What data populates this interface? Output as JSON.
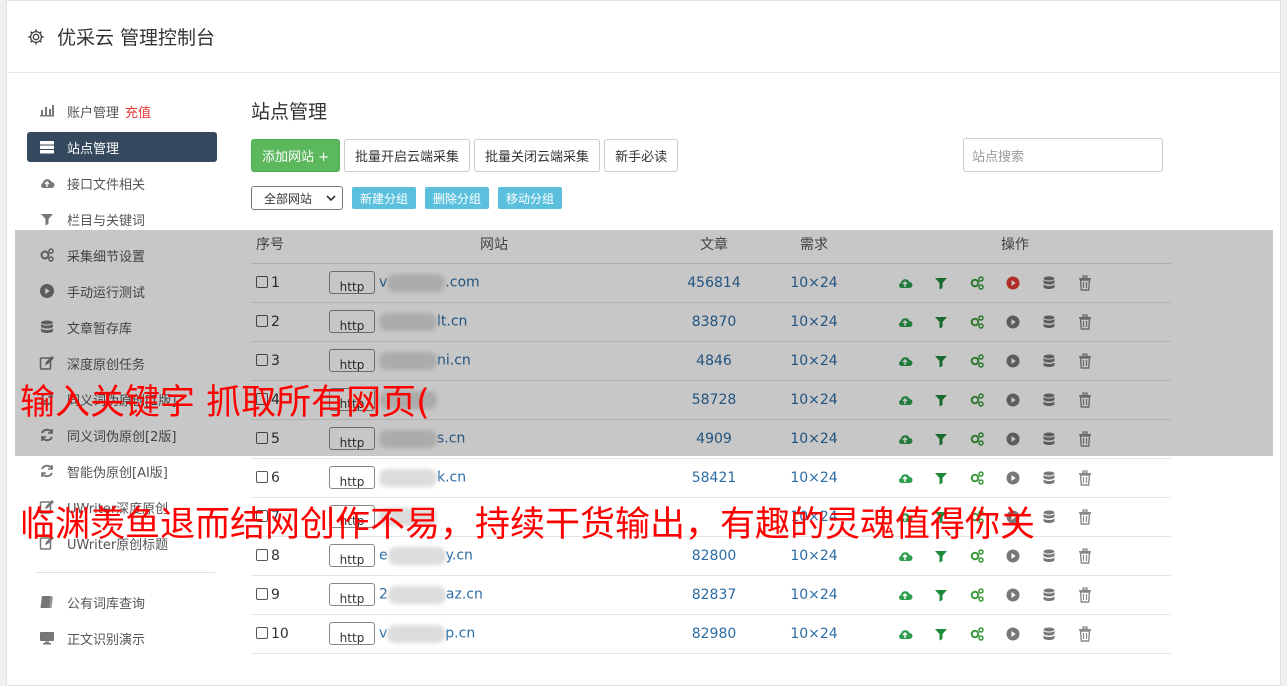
{
  "header": {
    "title": "优采云 管理控制台"
  },
  "sidebar": {
    "items": [
      {
        "label": "账户管理",
        "extra": "充值",
        "icon": "bar-chart-icon"
      },
      {
        "label": "站点管理",
        "icon": "server-icon",
        "active": true
      },
      {
        "label": "接口文件相关",
        "icon": "cloud-upload-icon"
      },
      {
        "label": "栏目与关键词",
        "icon": "filter-icon"
      },
      {
        "label": "采集细节设置",
        "icon": "gears-icon"
      },
      {
        "label": "手动运行测试",
        "icon": "play-circle-icon"
      },
      {
        "label": "文章暂存库",
        "icon": "database-icon"
      },
      {
        "label": "深度原创任务",
        "icon": "edit-icon"
      },
      {
        "label": "同义词伪原创[1版]",
        "icon": "refresh-icon"
      },
      {
        "label": "同义词伪原创[2版]",
        "icon": "refresh-icon"
      },
      {
        "label": "智能伪原创[AI版]",
        "icon": "refresh-icon"
      },
      {
        "label": "UWriter深度原创",
        "icon": "edit-icon"
      },
      {
        "label": "UWriter原创标题",
        "icon": "edit-icon"
      }
    ],
    "bottom_items": [
      {
        "label": "公有词库查询",
        "icon": "book-icon"
      },
      {
        "label": "正文识别演示",
        "icon": "monitor-icon"
      }
    ]
  },
  "main": {
    "title": "站点管理",
    "toolbar": {
      "add_site": "添加网站 +",
      "batch_open": "批量开启云端采集",
      "batch_close": "批量关闭云端采集",
      "guide": "新手必读",
      "search_placeholder": "站点搜索"
    },
    "group": {
      "select_value": "全部网站",
      "new_group": "新建分组",
      "delete_group": "删除分组",
      "move_group": "移动分组"
    },
    "table": {
      "headers": [
        "序号",
        "网站",
        "文章",
        "需求",
        "操作"
      ],
      "rows": [
        {
          "no": "1",
          "proto": "http",
          "pre": "v",
          "post": ".com",
          "articles": "456814",
          "need": "10×24",
          "play_active": true
        },
        {
          "no": "2",
          "proto": "http",
          "pre": "",
          "post": "lt.cn",
          "articles": "83870",
          "need": "10×24",
          "play_active": false
        },
        {
          "no": "3",
          "proto": "http",
          "pre": "",
          "post": "ni.cn",
          "articles": "4846",
          "need": "10×24",
          "play_active": false
        },
        {
          "no": "4",
          "proto": "http",
          "pre": "",
          "post": "",
          "articles": "58728",
          "need": "10×24",
          "play_active": false
        },
        {
          "no": "5",
          "proto": "http",
          "pre": "",
          "post": "s.cn",
          "articles": "4909",
          "need": "10×24",
          "play_active": false
        },
        {
          "no": "6",
          "proto": "http",
          "pre": "",
          "post": "k.cn",
          "articles": "58421",
          "need": "10×24",
          "play_active": false
        },
        {
          "no": "7",
          "proto": "http",
          "pre": "",
          "post": "",
          "articles": "",
          "need": "10×24",
          "play_active": false
        },
        {
          "no": "8",
          "proto": "http",
          "pre": "e",
          "post": "y.cn",
          "articles": "82800",
          "need": "10×24",
          "play_active": false
        },
        {
          "no": "9",
          "proto": "http",
          "pre": "2",
          "post": "az.cn",
          "articles": "82837",
          "need": "10×24",
          "play_active": false
        },
        {
          "no": "10",
          "proto": "http",
          "pre": "v",
          "post": "p.cn",
          "articles": "82980",
          "need": "10×24",
          "play_active": false
        }
      ]
    }
  },
  "watermark": {
    "line1": "输入关键字 抓取所有网页(",
    "line2": "临渊羡鱼退而结网创作不易，持续干货输出，有趣的灵魂值得你关"
  },
  "colors": {
    "active_bg": "#34495e",
    "green": "#5cb85c",
    "info": "#5bc0de",
    "link": "#2c6ca5",
    "watermark": "#ff0000"
  }
}
